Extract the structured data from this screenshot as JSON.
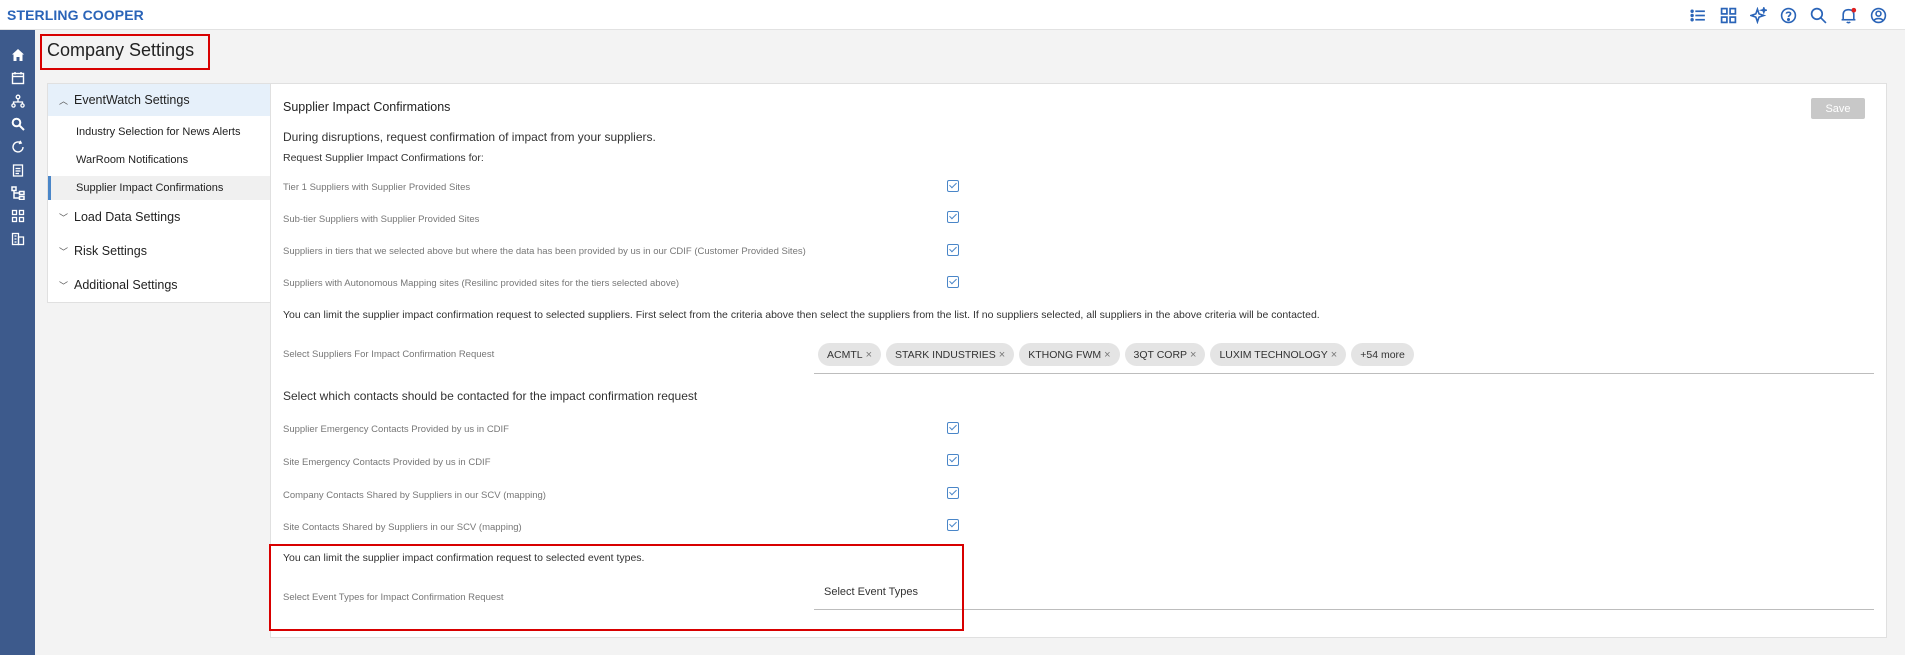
{
  "brand": "STERLING COOPER",
  "top_icons": [
    "list-icon",
    "grid-icon",
    "sparkle-icon",
    "help-icon",
    "search-icon",
    "bell-icon",
    "user-icon"
  ],
  "side_nav": [
    "home-icon",
    "calendar-icon",
    "network-icon",
    "search-icon",
    "refresh-icon",
    "clipboard-icon",
    "hierarchy-icon",
    "apps-icon",
    "building-icon"
  ],
  "page_title": "Company Settings",
  "left_panel": {
    "sections": [
      {
        "label": "EventWatch Settings",
        "expanded": true,
        "items": [
          "Industry Selection for News Alerts",
          "WarRoom Notifications",
          "Supplier Impact Confirmations"
        ],
        "active_item": "Supplier Impact Confirmations"
      },
      {
        "label": "Load Data Settings",
        "expanded": false
      },
      {
        "label": "Risk Settings",
        "expanded": false
      },
      {
        "label": "Additional Settings",
        "expanded": false
      }
    ]
  },
  "main": {
    "title": "Supplier Impact Confirmations",
    "save_label": "Save",
    "intro_heading": "During disruptions, request confirmation of impact from your suppliers.",
    "request_heading": "Request Supplier Impact Confirmations for:",
    "supplier_rows": [
      {
        "label": "Tier 1 Suppliers with Supplier Provided Sites",
        "checked": true
      },
      {
        "label": "Sub-tier Suppliers with Supplier Provided Sites",
        "checked": true
      },
      {
        "label": "Suppliers in tiers that we selected above but where the data has been provided by us in our CDIF (Customer Provided Sites)",
        "checked": true
      },
      {
        "label": "Suppliers with Autonomous Mapping sites (Resilinc provided sites for the tiers selected above)",
        "checked": true
      }
    ],
    "limit_suppliers_note": "You can limit the supplier impact confirmation request to selected suppliers. First select from the criteria above then select the suppliers from the list. If no suppliers selected, all suppliers in the above criteria will be contacted.",
    "select_suppliers_label": "Select Suppliers For Impact Confirmation Request",
    "supplier_chips": [
      "ACMTL",
      "STARK INDUSTRIES",
      "KTHONG FWM",
      "3QT CORP",
      "LUXIM TECHNOLOGY"
    ],
    "chip_remove_glyph": "×",
    "more_chip": "+54 more",
    "contacts_heading": "Select which contacts should be contacted for the impact confirmation request",
    "contact_rows": [
      {
        "label": "Supplier Emergency Contacts Provided by us in CDIF",
        "checked": true
      },
      {
        "label": "Site Emergency Contacts Provided by us in CDIF",
        "checked": true
      },
      {
        "label": "Company Contacts Shared by Suppliers in our SCV (mapping)",
        "checked": true
      },
      {
        "label": "Site Contacts Shared by Suppliers in our SCV (mapping)",
        "checked": true
      }
    ],
    "event_types_note": "You can limit the supplier impact confirmation request to selected event types.",
    "event_types_label": "Select Event Types for Impact Confirmation Request",
    "event_types_placeholder": "Select Event Types"
  },
  "colors": {
    "brand": "#2a64b8",
    "sidenav": "#3d5a8c",
    "accent": "#4a86c8",
    "highlight_box": "#d80000"
  }
}
